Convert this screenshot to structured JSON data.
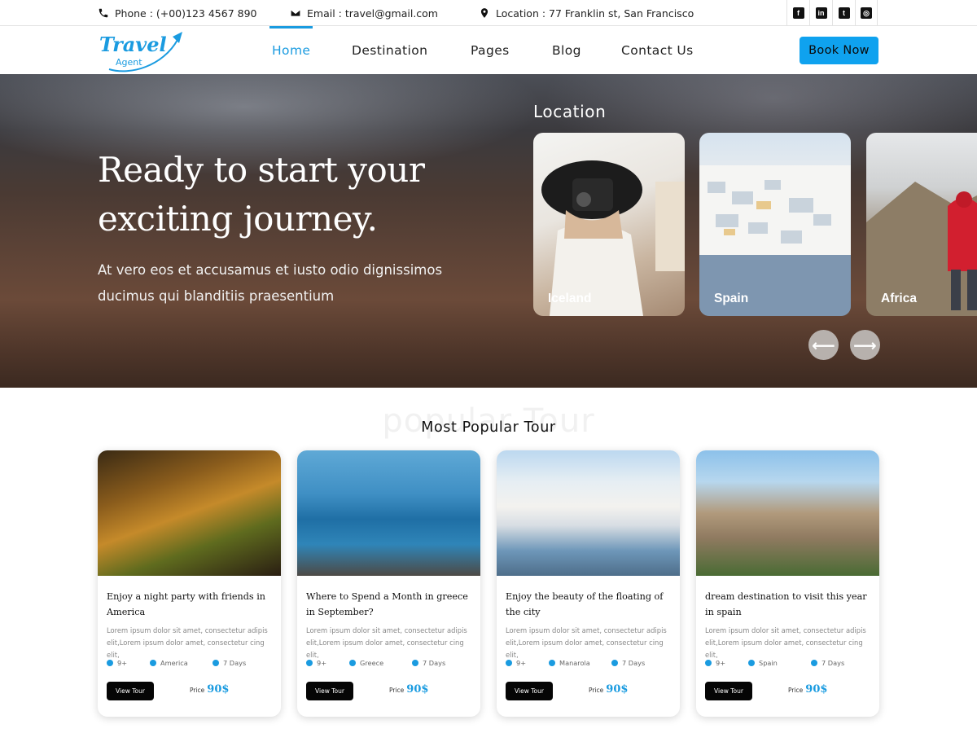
{
  "topbar": {
    "phone": "Phone : (+00)123 4567 890",
    "email": "Email : travel@gmail.com",
    "location": "Location : 77 Franklin st, San Francisco",
    "social": [
      "facebook-icon",
      "linkedin-icon",
      "twitter-icon",
      "instagram-icon"
    ]
  },
  "brand": {
    "logo_line1": "Travel",
    "logo_line2": "Agent",
    "color": "#1a9be0"
  },
  "nav": {
    "items": [
      {
        "label": "Home",
        "active": true
      },
      {
        "label": "Destination",
        "active": false
      },
      {
        "label": "Pages",
        "active": false
      },
      {
        "label": "Blog",
        "active": false
      },
      {
        "label": "Contact Us",
        "active": false
      }
    ],
    "book_label": "Book Now"
  },
  "hero": {
    "title": "Ready to start your exciting journey.",
    "subtitle": "At vero eos et accusamus et iusto odio dignissimos ducimus qui blanditiis praesentium",
    "location_heading": "Location",
    "locations": [
      {
        "name": "Iceland"
      },
      {
        "name": "Spain"
      },
      {
        "name": "Africa"
      }
    ],
    "prev_icon": "arrow-left-icon",
    "next_icon": "arrow-right-icon"
  },
  "popular": {
    "background_text": "popular Tour",
    "title": "Most Popular Tour",
    "tours": [
      {
        "title": "Enjoy a night party with friends in America",
        "desc": "Lorem ipsum dolor sit amet, consectetur adipis elit,Lorem ipsum dolor amet, consectetur cing elit,",
        "people": "9+",
        "place": "America",
        "days": "7 Days",
        "button": "View Tour",
        "price_label": "Price",
        "price": "90$"
      },
      {
        "title": "Where to Spend a Month in greece in September?",
        "desc": "Lorem ipsum dolor sit amet, consectetur adipis elit,Lorem ipsum dolor amet, consectetur cing elit,",
        "people": "9+",
        "place": "Greece",
        "days": "7 Days",
        "button": "View Tour",
        "price_label": "Price",
        "price": "90$"
      },
      {
        "title": "Enjoy the beauty of the floating of the city",
        "desc": "Lorem ipsum dolor sit amet, consectetur adipis elit,Lorem ipsum dolor amet, consectetur cing elit,",
        "people": "9+",
        "place": "Manarola",
        "days": "7 Days",
        "button": "View Tour",
        "price_label": "Price",
        "price": "90$"
      },
      {
        "title": "dream destination to visit this year in spain",
        "desc": "Lorem ipsum dolor sit amet, consectetur adipis elit,Lorem ipsum dolor amet, consectetur cing elit,",
        "people": "9+",
        "place": "Spain",
        "days": "7 Days",
        "button": "View Tour",
        "price_label": "Price",
        "price": "90$"
      }
    ]
  },
  "colors": {
    "accent": "#1a9be0",
    "button": "#0fa2ef"
  }
}
